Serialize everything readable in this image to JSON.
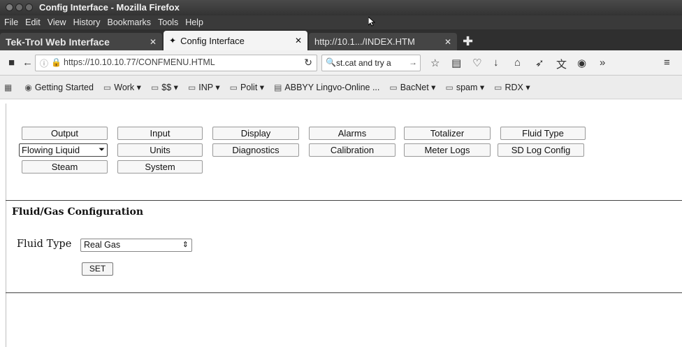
{
  "window": {
    "title": "Config Interface - Mozilla Firefox"
  },
  "menubar": {
    "items": [
      "File",
      "Edit",
      "View",
      "History",
      "Bookmarks",
      "Tools",
      "Help"
    ]
  },
  "tabs": [
    {
      "label": "Tek-Trol Web Interface",
      "active": false
    },
    {
      "label": "Config Interface",
      "active": true
    },
    {
      "label": "http://10.1.../INDEX.HTM",
      "active": false
    }
  ],
  "navbar": {
    "url": "https://10.10.10.77/CONFMENU.HTML",
    "search_value": "st.cat and try a"
  },
  "bookmarks": [
    {
      "label": "Getting Started",
      "icon": "firefox-icon"
    },
    {
      "label": "Work ▾",
      "icon": "folder-icon"
    },
    {
      "label": "$$ ▾",
      "icon": "folder-icon"
    },
    {
      "label": "INP ▾",
      "icon": "folder-icon"
    },
    {
      "label": "Polit ▾",
      "icon": "folder-icon"
    },
    {
      "label": "ABBYY Lingvo-Online ...",
      "icon": "page-icon"
    },
    {
      "label": "BacNet ▾",
      "icon": "folder-icon"
    },
    {
      "label": "spam ▾",
      "icon": "folder-icon"
    },
    {
      "label": "RDX ▾",
      "icon": "folder-icon"
    }
  ],
  "menu_buttons": {
    "output": "Output",
    "input": "Input",
    "display": "Display",
    "alarms": "Alarms",
    "totalizer": "Totalizer",
    "fluid_type": "Fluid Type",
    "flowing_liquid": "Flowing Liquid",
    "units": "Units",
    "diagnostics": "Diagnostics",
    "calibration": "Calibration",
    "meter_logs": "Meter Logs",
    "sd_log_config": "SD Log Config",
    "steam": "Steam",
    "system": "System"
  },
  "section": {
    "title": "Fluid/Gas Configuration",
    "fluid_type_label": "Fluid Type",
    "fluid_type_value": "Real Gas",
    "set_label": "SET"
  }
}
